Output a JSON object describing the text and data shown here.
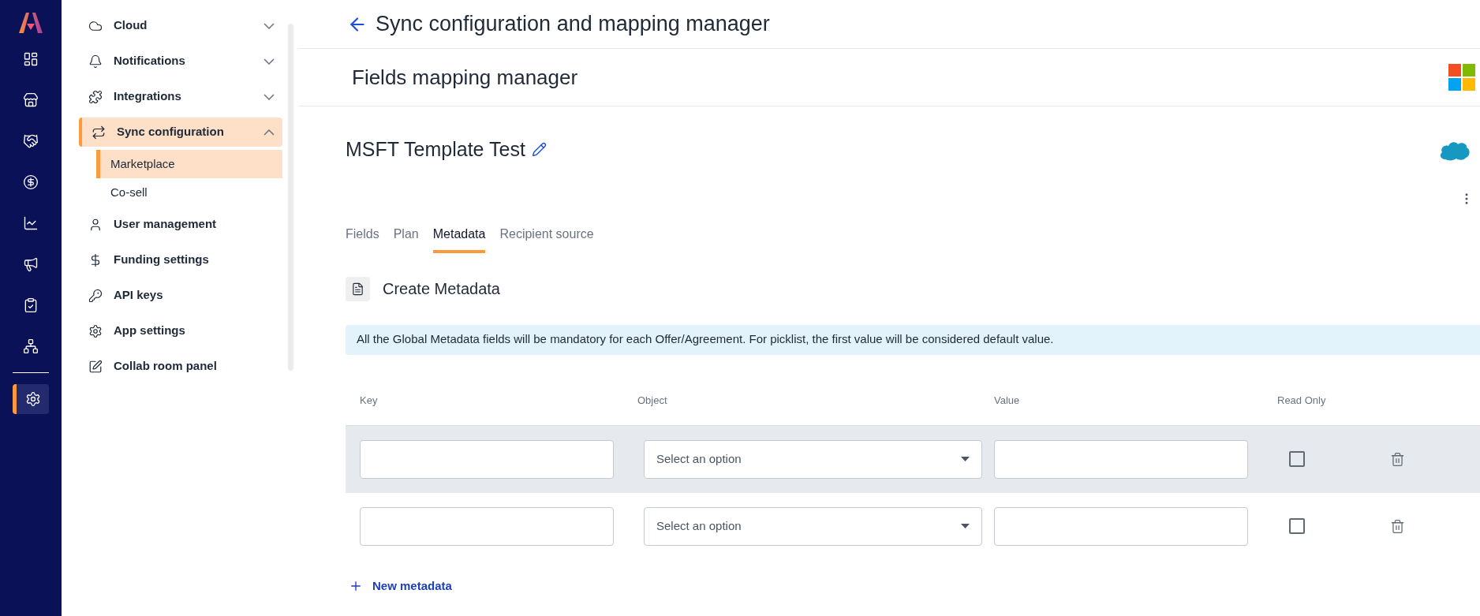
{
  "rail": {
    "items": [
      {
        "selected": false
      },
      {
        "selected": false
      },
      {
        "selected": false
      },
      {
        "selected": false
      },
      {
        "selected": false
      },
      {
        "selected": false
      },
      {
        "selected": false
      },
      {
        "selected": false
      },
      {
        "selected": true
      }
    ]
  },
  "sidebar": {
    "items": [
      {
        "label": "Cloud",
        "expanded": false,
        "selected": false
      },
      {
        "label": "Notifications",
        "expanded": false,
        "selected": false
      },
      {
        "label": "Integrations",
        "expanded": false,
        "selected": false
      },
      {
        "label": "Sync configuration",
        "expanded": true,
        "selected": true,
        "children": [
          {
            "label": "Marketplace",
            "selected": true
          },
          {
            "label": "Co-sell",
            "selected": false
          }
        ]
      },
      {
        "label": "User management",
        "selected": false
      },
      {
        "label": "Funding settings",
        "selected": false
      },
      {
        "label": "API keys",
        "selected": false
      },
      {
        "label": "App settings",
        "selected": false
      },
      {
        "label": "Collab room panel",
        "selected": false
      }
    ]
  },
  "page": {
    "title": "Sync configuration and mapping manager"
  },
  "section": {
    "title": "Fields mapping manager"
  },
  "template": {
    "name": "MSFT Template Test"
  },
  "tabs": [
    {
      "label": "Fields",
      "selected": false
    },
    {
      "label": "Plan",
      "selected": false
    },
    {
      "label": "Metadata",
      "selected": true
    },
    {
      "label": "Recipient source",
      "selected": false
    }
  ],
  "metadata": {
    "title": "Create Metadata",
    "notice": "All the Global Metadata fields will be mandatory for each Offer/Agreement. For picklist, the first value will be considered default value."
  },
  "table": {
    "columns": [
      "Key",
      "Object",
      "Value",
      "Read Only"
    ],
    "rows": [
      {
        "object_placeholder": "Select an option",
        "read_only": false,
        "highlighted": true
      },
      {
        "object_placeholder": "Select an option",
        "read_only": false,
        "highlighted": false
      }
    ]
  },
  "add_button": "New metadata"
}
